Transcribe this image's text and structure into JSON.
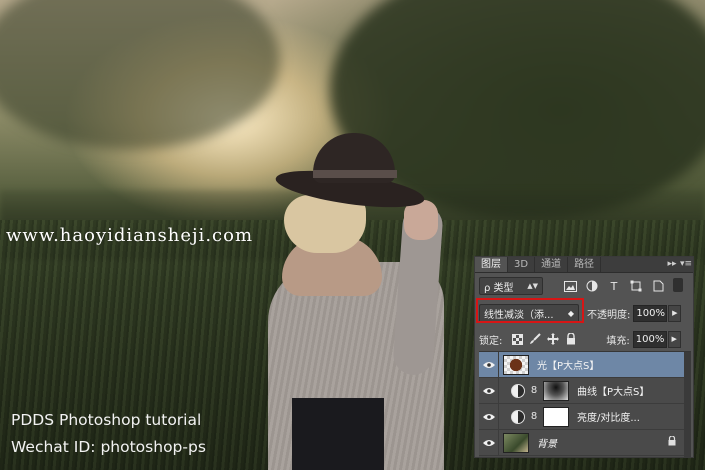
{
  "watermark": "www.haoyidiansheji.com",
  "captions": {
    "line1": "PDDS Photoshop tutorial",
    "line2": "Wechat ID: photoshop-ps"
  },
  "panel": {
    "tabs": [
      "图层",
      "3D",
      "通道",
      "路径"
    ],
    "menu_glyphs": {
      "collapse": "▸▸",
      "menu": "▾≡"
    },
    "filter": {
      "kind_label": "ρ 类型",
      "icons": [
        "image-filter-icon",
        "adjustment-filter-icon",
        "type-filter-icon",
        "shape-filter-icon",
        "smart-object-filter-icon"
      ],
      "type_glyph": "T"
    },
    "blend_mode": "线性减淡（添...",
    "opacity_label": "不透明度:",
    "opacity_value": "100%",
    "lock_label": "锁定:",
    "fill_label": "填充:",
    "fill_value": "100%",
    "layers": [
      {
        "name": "光【P大点S】",
        "selected": true
      },
      {
        "name": "曲线【P大点S】",
        "selected": false
      },
      {
        "name": "亮度/对比度...",
        "selected": false
      },
      {
        "name": "背景",
        "selected": false
      }
    ],
    "highlight_color": "#d71515"
  }
}
